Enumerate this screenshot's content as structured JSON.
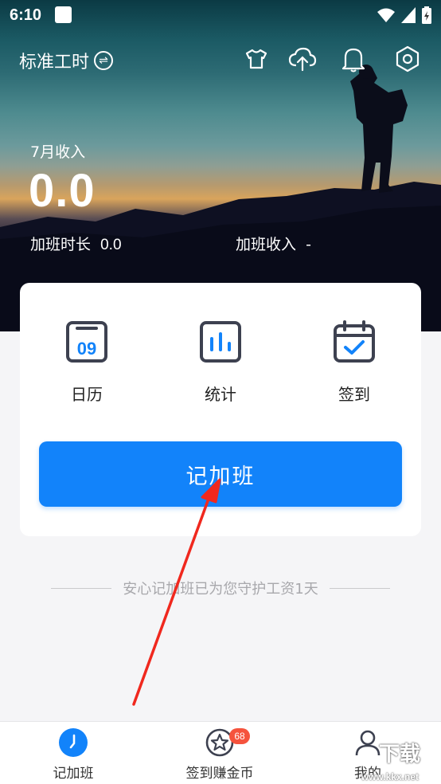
{
  "status": {
    "time": "6:10"
  },
  "header": {
    "title": "标准工时",
    "switch_icon": "switch-icon"
  },
  "summary": {
    "month_income_label": "7月收入",
    "month_income_value": "0.0",
    "ot_hours_label": "加班时长",
    "ot_hours_value": "0.0",
    "ot_income_label": "加班收入",
    "ot_income_value": "-"
  },
  "features": [
    {
      "label": "日历",
      "icon": "calendar-date-icon",
      "icon_text": "09"
    },
    {
      "label": "统计",
      "icon": "statistics-icon"
    },
    {
      "label": "签到",
      "icon": "check-in-icon"
    }
  ],
  "main_button": {
    "label": "记加班"
  },
  "guard_text": "安心记加班已为您守护工资1天",
  "tabs": [
    {
      "label": "记加班",
      "icon": "clock-icon",
      "active": true
    },
    {
      "label": "签到赚金币",
      "icon": "star-coin-icon",
      "badge": "68"
    },
    {
      "label": "我的",
      "icon": "user-icon"
    }
  ],
  "watermark": {
    "big": "下载",
    "small": "www.kkx.net"
  },
  "colors": {
    "accent": "#1283fa",
    "badge": "#f5533d",
    "annotation_arrow": "#f0281e"
  }
}
